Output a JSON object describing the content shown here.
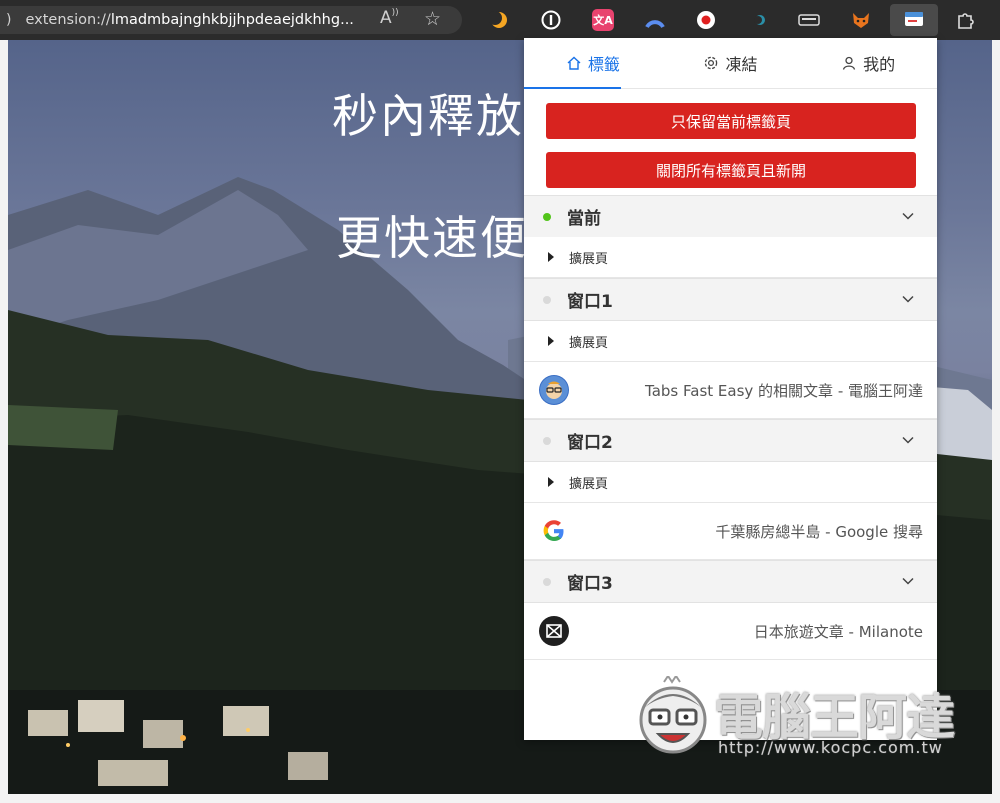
{
  "browser": {
    "url_prefix": "extension://",
    "url_rest": "lmadmbajnghkbjjhpdeaejdkhhg...",
    "read_aloud_glyph": "A",
    "active_extension": "tabs-fast-easy"
  },
  "hero": {
    "line1": "秒內釋放",
    "line2": "更快速便"
  },
  "popup": {
    "tabs": [
      {
        "label": "標籤",
        "icon": "home-icon"
      },
      {
        "label": "凍結",
        "icon": "gear-icon"
      },
      {
        "label": "我的",
        "icon": "user-icon"
      }
    ],
    "buttons": {
      "keep_current": "只保留當前標籤頁",
      "close_all": "關閉所有標籤頁且新開"
    },
    "groups": [
      {
        "title": "當前",
        "status_color": "#52c41a",
        "subgroup": "擴展頁",
        "tabs": []
      },
      {
        "title": "窗口1",
        "status_color": "#d9d9d9",
        "subgroup": "擴展頁",
        "tabs": [
          {
            "title": "Tabs Fast Easy 的相關文章 - 電腦王阿達",
            "icon": "koopc-avatar-icon"
          }
        ]
      },
      {
        "title": "窗口2",
        "status_color": "#d9d9d9",
        "subgroup": "擴展頁",
        "tabs": [
          {
            "title": "千葉縣房總半島 - Google 搜尋",
            "icon": "google-icon"
          }
        ]
      },
      {
        "title": "窗口3",
        "status_color": "#d9d9d9",
        "subgroup": "",
        "tabs": [
          {
            "title": "日本旅遊文章 - Milanote",
            "icon": "milanote-icon"
          }
        ]
      }
    ]
  },
  "watermark": {
    "brand": "電腦王阿達",
    "url": "http://www.kocpc.com.tw"
  }
}
